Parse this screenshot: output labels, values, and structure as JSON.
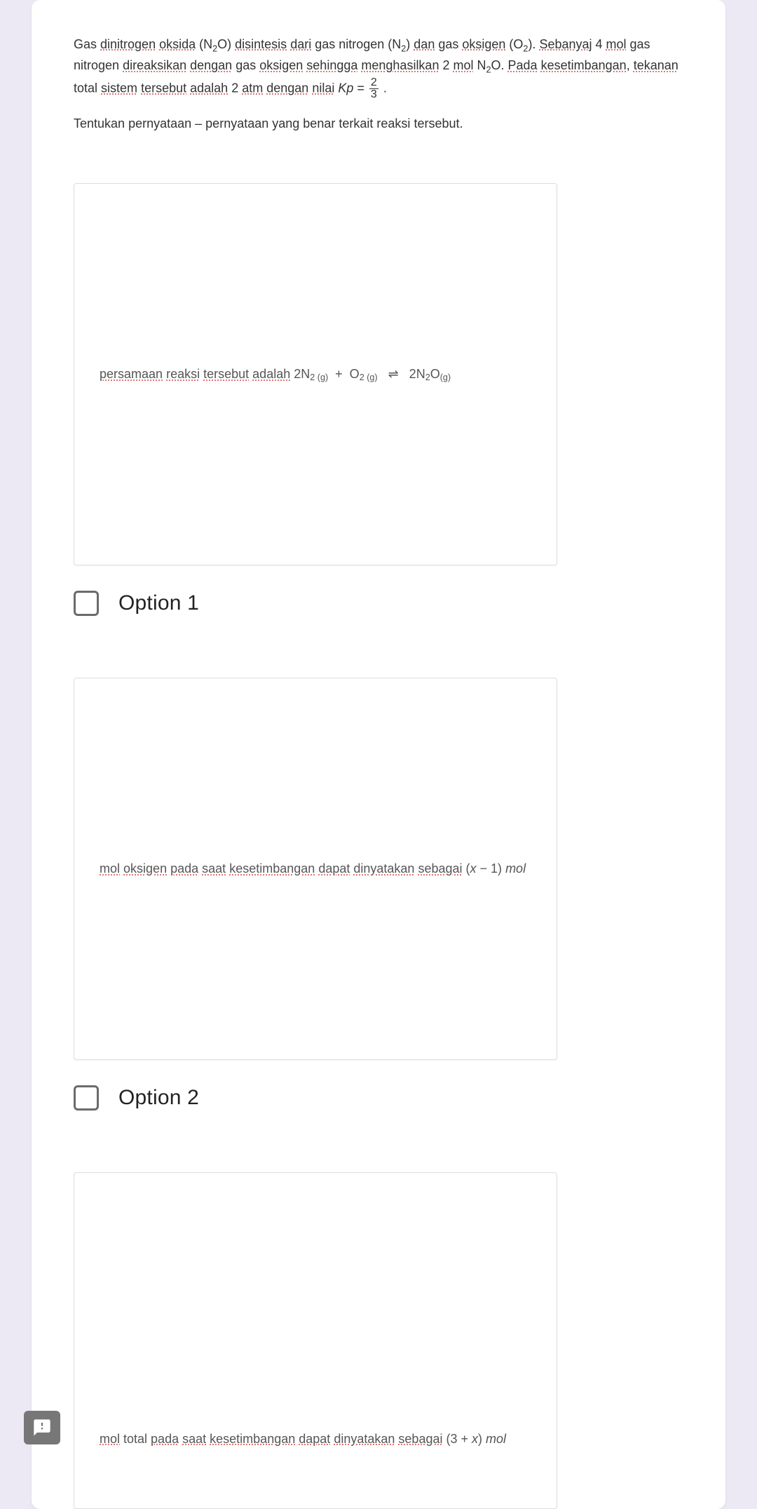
{
  "question": {
    "line1_plain": "Gas dinitrogen oksida (N₂O) disintesis dari gas nitrogen (N₂) dan gas oksigen (O₂). Sebanyaj 4 mol gas nitrogen direaksikan dengan gas oksigen sehingga menghasilkan 2 mol N₂O. Pada kesetimbangan, tekanan total sistem tersebut adalah 2 atm dengan nilai Kp = 2/3 .",
    "kp_num": "2",
    "kp_den": "3",
    "instruction": "Tentukan pernyataan – pernyataan yang benar terkait reaksi tersebut."
  },
  "options": [
    {
      "image_text_plain": "persamaan reaksi tersebut adalah 2N₂ (g)  +  O₂ (g)   ⇌   2N₂O(g)",
      "label": "Option 1"
    },
    {
      "image_text_plain": "mol oksigen pada saat kesetimbangan dapat dinyatakan sebagai (x − 1) mol",
      "label": "Option 2"
    },
    {
      "image_text_plain": "mol total pada saat kesetimbangan dapat dinyatakan sebagai (3 + x) mol",
      "label": ""
    }
  ],
  "icons": {
    "feedback": "feedback-icon"
  }
}
